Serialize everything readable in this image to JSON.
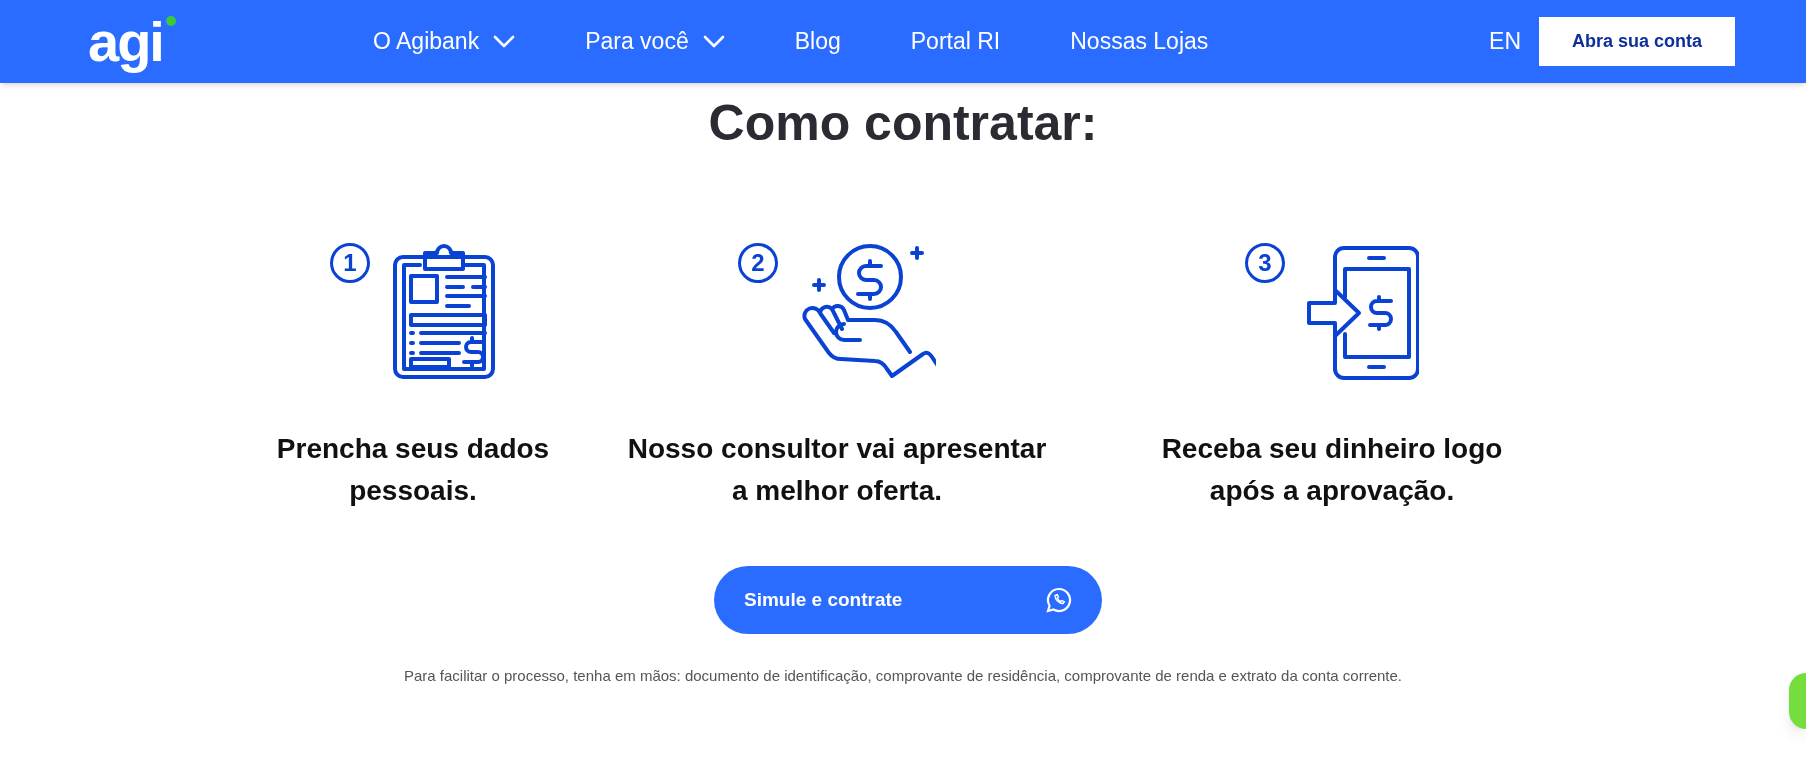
{
  "header": {
    "logo": "agi",
    "nav": [
      {
        "label": "O Agibank",
        "kind": "dropdown"
      },
      {
        "label": "Para você",
        "kind": "dropdown"
      },
      {
        "label": "Blog",
        "kind": "link"
      },
      {
        "label": "Portal RI",
        "kind": "link"
      },
      {
        "label": "Nossas Lojas",
        "kind": "link"
      }
    ],
    "language": "EN",
    "cta": "Abra sua conta"
  },
  "title": "Como contratar:",
  "steps": [
    {
      "number": "1",
      "kind": "clipboard",
      "text": "Prencha seus dados pessoais."
    },
    {
      "number": "2",
      "kind": "hand-coin",
      "text": "Nosso consultor vai apresentar a melhor oferta."
    },
    {
      "number": "3",
      "kind": "phone-transfer",
      "text": "Receba seu dinheiro logo após a aprovação."
    }
  ],
  "action_button": "Simule e contrate",
  "note": "Para facilitar o processo, tenha em mãos: documento de identificação, comprovante de residência, comprovante de renda e extrato da conta corrente."
}
